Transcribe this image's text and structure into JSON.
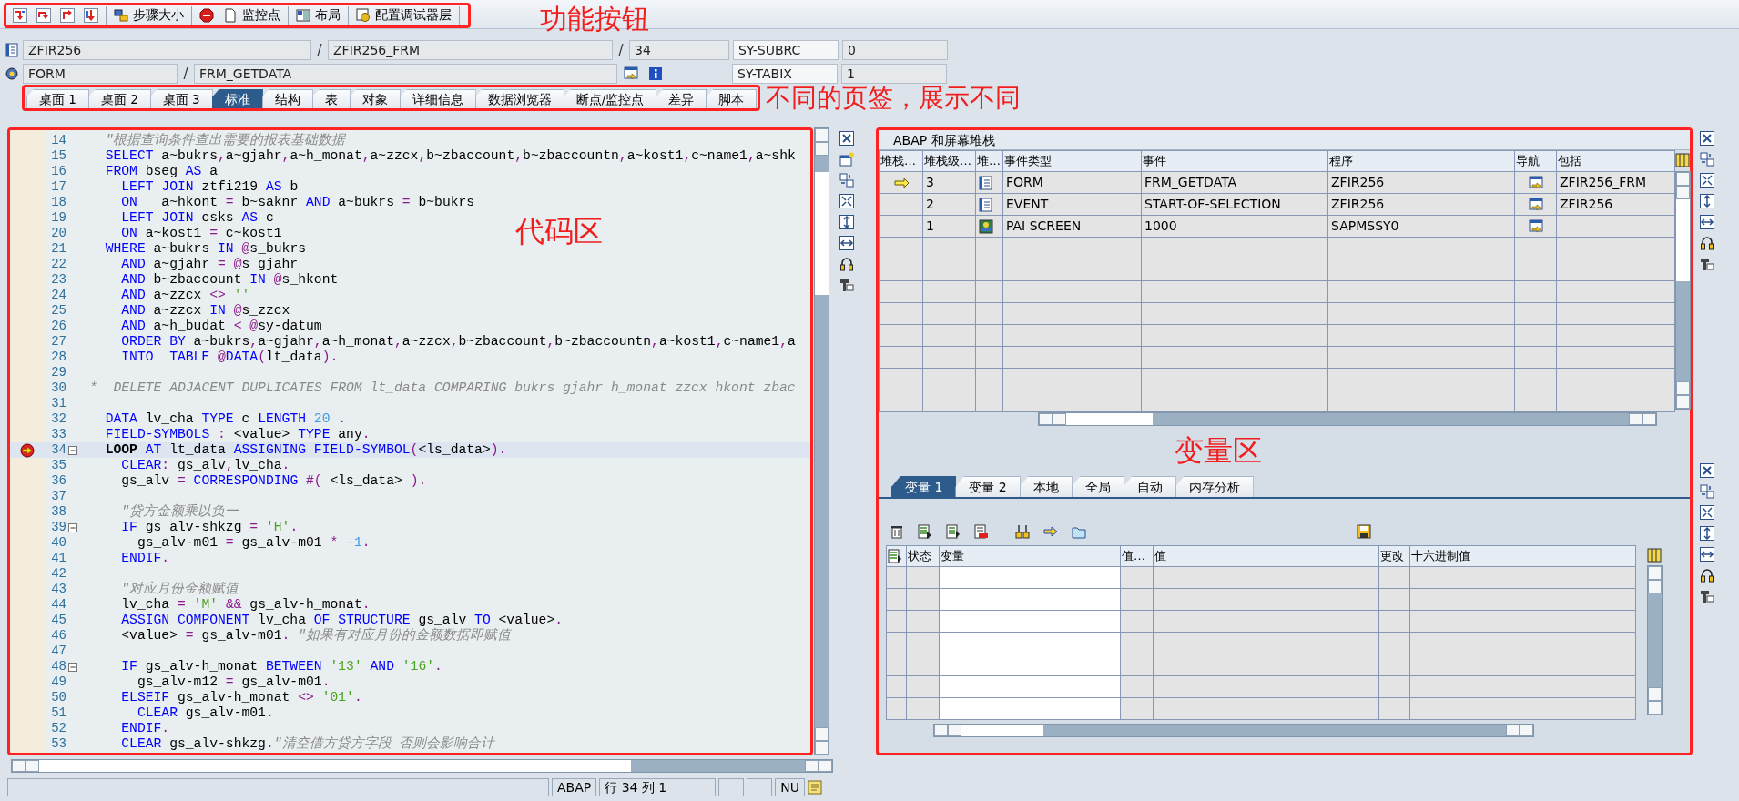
{
  "toolbar": {
    "annotation": "功能按钮",
    "buttons": [
      {
        "kind": "step-into"
      },
      {
        "kind": "step-over"
      },
      {
        "kind": "step-return"
      },
      {
        "kind": "continue"
      },
      {
        "kind": "step-size",
        "label": "步骤大小"
      },
      {
        "kind": "stop"
      },
      {
        "kind": "watchpoint",
        "label": "监控点"
      },
      {
        "kind": "layout",
        "label": "布局"
      },
      {
        "kind": "layers",
        "label": "配置调试器层"
      }
    ]
  },
  "header": {
    "rows": [
      {
        "kind": "program",
        "items": [
          {
            "kind": "field",
            "text": "ZFIR256"
          },
          {
            "kind": "sep",
            "text": "/"
          },
          {
            "kind": "field",
            "text": "ZFIR256_FRM"
          },
          {
            "kind": "sep",
            "text": "/"
          },
          {
            "kind": "field",
            "text": "34"
          }
        ],
        "sys_field": {
          "name": "SY-SUBRC",
          "value": "0"
        }
      },
      {
        "kind": "event",
        "items": [
          {
            "kind": "field",
            "text": "FORM"
          },
          {
            "kind": "sep",
            "text": "/"
          },
          {
            "kind": "field",
            "text": "FRM_GETDATA"
          },
          {
            "kind": "nav"
          },
          {
            "kind": "info"
          }
        ],
        "sys_field": {
          "name": "SY-TABIX",
          "value": "1"
        }
      }
    ]
  },
  "desktop_tabs": {
    "annotation": "不同的页签，展示不同",
    "tabs": [
      {
        "label": "桌面 1",
        "selected": false
      },
      {
        "label": "桌面 2",
        "selected": false
      },
      {
        "label": "桌面 3",
        "selected": false
      },
      {
        "label": "标准",
        "selected": true
      },
      {
        "label": "结构",
        "selected": false
      },
      {
        "label": "表",
        "selected": false
      },
      {
        "label": "对象",
        "selected": false
      },
      {
        "label": "详细信息",
        "selected": false
      },
      {
        "label": "数据浏览器",
        "selected": false
      },
      {
        "label": "断点/监控点",
        "selected": false
      },
      {
        "label": "差异",
        "selected": false
      },
      {
        "label": "脚本",
        "selected": false
      }
    ]
  },
  "code_area": {
    "annotation": "代码区",
    "lines": [
      {
        "n": "14",
        "current": false,
        "fold": false,
        "tokens": [
          {
            "kind": "c",
            "text": "  \"根据查询条件查出需要的报表基础数据"
          }
        ]
      },
      {
        "n": "15",
        "current": false,
        "fold": false,
        "tokens": [
          {
            "kind": "kw",
            "text": "  SELECT"
          },
          {
            "kind": "t",
            "text": " a~bukrs"
          },
          {
            "kind": "o",
            "text": ","
          },
          {
            "kind": "t",
            "text": "a~gjahr"
          },
          {
            "kind": "o",
            "text": ","
          },
          {
            "kind": "t",
            "text": "a~h_monat"
          },
          {
            "kind": "o",
            "text": ","
          },
          {
            "kind": "t",
            "text": "a~zzcx"
          },
          {
            "kind": "o",
            "text": ","
          },
          {
            "kind": "t",
            "text": "b~zbaccount"
          },
          {
            "kind": "o",
            "text": ","
          },
          {
            "kind": "t",
            "text": "b~zbaccountn"
          },
          {
            "kind": "o",
            "text": ","
          },
          {
            "kind": "t",
            "text": "a~kost1"
          },
          {
            "kind": "o",
            "text": ","
          },
          {
            "kind": "t",
            "text": "c~name1"
          },
          {
            "kind": "o",
            "text": ","
          },
          {
            "kind": "t",
            "text": "a~shk"
          }
        ]
      },
      {
        "n": "16",
        "current": false,
        "fold": false,
        "tokens": [
          {
            "kind": "kw",
            "text": "  FROM"
          },
          {
            "kind": "t",
            "text": " bseg "
          },
          {
            "kind": "kw",
            "text": "AS"
          },
          {
            "kind": "t",
            "text": " a"
          }
        ]
      },
      {
        "n": "17",
        "current": false,
        "fold": false,
        "tokens": [
          {
            "kind": "kw",
            "text": "    LEFT JOIN"
          },
          {
            "kind": "t",
            "text": " ztfi219 "
          },
          {
            "kind": "kw",
            "text": "AS"
          },
          {
            "kind": "t",
            "text": " b"
          }
        ]
      },
      {
        "n": "18",
        "current": false,
        "fold": false,
        "tokens": [
          {
            "kind": "kw",
            "text": "    ON"
          },
          {
            "kind": "t",
            "text": "   a~hkont "
          },
          {
            "kind": "o",
            "text": "="
          },
          {
            "kind": "t",
            "text": " b~saknr "
          },
          {
            "kind": "kw",
            "text": "AND"
          },
          {
            "kind": "t",
            "text": " a~bukrs "
          },
          {
            "kind": "o",
            "text": "="
          },
          {
            "kind": "t",
            "text": " b~bukrs"
          }
        ]
      },
      {
        "n": "19",
        "current": false,
        "fold": false,
        "tokens": [
          {
            "kind": "kw",
            "text": "    LEFT JOIN"
          },
          {
            "kind": "t",
            "text": " csks "
          },
          {
            "kind": "kw",
            "text": "AS"
          },
          {
            "kind": "t",
            "text": " c"
          }
        ]
      },
      {
        "n": "20",
        "current": false,
        "fold": false,
        "tokens": [
          {
            "kind": "kw",
            "text": "    ON"
          },
          {
            "kind": "t",
            "text": " a~kost1 "
          },
          {
            "kind": "o",
            "text": "="
          },
          {
            "kind": "t",
            "text": " c~kost1"
          }
        ]
      },
      {
        "n": "21",
        "current": false,
        "fold": false,
        "tokens": [
          {
            "kind": "kw",
            "text": "  WHERE"
          },
          {
            "kind": "t",
            "text": " a~bukrs "
          },
          {
            "kind": "kw",
            "text": "IN"
          },
          {
            "kind": "o",
            "text": " @"
          },
          {
            "kind": "t",
            "text": "s_bukrs"
          }
        ]
      },
      {
        "n": "22",
        "current": false,
        "fold": false,
        "tokens": [
          {
            "kind": "kw",
            "text": "    AND"
          },
          {
            "kind": "t",
            "text": " a~gjahr "
          },
          {
            "kind": "o",
            "text": "= @"
          },
          {
            "kind": "t",
            "text": "s_gjahr"
          }
        ]
      },
      {
        "n": "23",
        "current": false,
        "fold": false,
        "tokens": [
          {
            "kind": "kw",
            "text": "    AND"
          },
          {
            "kind": "t",
            "text": " b~zbaccount "
          },
          {
            "kind": "kw",
            "text": "IN"
          },
          {
            "kind": "o",
            "text": " @"
          },
          {
            "kind": "t",
            "text": "s_hkont"
          }
        ]
      },
      {
        "n": "24",
        "current": false,
        "fold": false,
        "tokens": [
          {
            "kind": "kw",
            "text": "    AND"
          },
          {
            "kind": "t",
            "text": " a~zzcx "
          },
          {
            "kind": "o",
            "text": "<>"
          },
          {
            "kind": "s",
            "text": " ''"
          }
        ]
      },
      {
        "n": "25",
        "current": false,
        "fold": false,
        "tokens": [
          {
            "kind": "kw",
            "text": "    AND"
          },
          {
            "kind": "t",
            "text": " a~zzcx "
          },
          {
            "kind": "kw",
            "text": "IN"
          },
          {
            "kind": "o",
            "text": " @"
          },
          {
            "kind": "t",
            "text": "s_zzcx"
          }
        ]
      },
      {
        "n": "26",
        "current": false,
        "fold": false,
        "tokens": [
          {
            "kind": "kw",
            "text": "    AND"
          },
          {
            "kind": "t",
            "text": " a~h_budat "
          },
          {
            "kind": "o",
            "text": "< @"
          },
          {
            "kind": "t",
            "text": "sy-datum"
          }
        ]
      },
      {
        "n": "27",
        "current": false,
        "fold": false,
        "tokens": [
          {
            "kind": "kw",
            "text": "    ORDER BY"
          },
          {
            "kind": "t",
            "text": " a~bukrs"
          },
          {
            "kind": "o",
            "text": ","
          },
          {
            "kind": "t",
            "text": "a~gjahr"
          },
          {
            "kind": "o",
            "text": ","
          },
          {
            "kind": "t",
            "text": "a~h_monat"
          },
          {
            "kind": "o",
            "text": ","
          },
          {
            "kind": "t",
            "text": "a~zzcx"
          },
          {
            "kind": "o",
            "text": ","
          },
          {
            "kind": "t",
            "text": "b~zbaccount"
          },
          {
            "kind": "o",
            "text": ","
          },
          {
            "kind": "t",
            "text": "b~zbaccountn"
          },
          {
            "kind": "o",
            "text": ","
          },
          {
            "kind": "t",
            "text": "a~kost1"
          },
          {
            "kind": "o",
            "text": ","
          },
          {
            "kind": "t",
            "text": "c~name1"
          },
          {
            "kind": "o",
            "text": ","
          },
          {
            "kind": "t",
            "text": "a"
          }
        ]
      },
      {
        "n": "28",
        "current": false,
        "fold": false,
        "tokens": [
          {
            "kind": "kw",
            "text": "    INTO  TABLE"
          },
          {
            "kind": "o",
            "text": " @"
          },
          {
            "kind": "kw",
            "text": "DATA"
          },
          {
            "kind": "o",
            "text": "("
          },
          {
            "kind": "t",
            "text": "lt_data"
          },
          {
            "kind": "o",
            "text": ")."
          }
        ]
      },
      {
        "n": "29",
        "current": false,
        "fold": false
      },
      {
        "n": "30",
        "current": false,
        "fold": false,
        "tokens": [
          {
            "kind": "c",
            "text": "*  DELETE ADJACENT DUPLICATES FROM lt_data COMPARING bukrs gjahr h_monat zzcx hkont zbac"
          }
        ]
      },
      {
        "n": "31",
        "current": false,
        "fold": false
      },
      {
        "n": "32",
        "current": false,
        "fold": false,
        "tokens": [
          {
            "kind": "kw",
            "text": "  DATA"
          },
          {
            "kind": "t",
            "text": " lv_cha "
          },
          {
            "kind": "kw",
            "text": "TYPE"
          },
          {
            "kind": "t",
            "text": " c "
          },
          {
            "kind": "kw",
            "text": "LENGTH"
          },
          {
            "kind": "n",
            "text": " 20"
          },
          {
            "kind": "o",
            "text": " ."
          }
        ]
      },
      {
        "n": "33",
        "current": false,
        "fold": false,
        "tokens": [
          {
            "kind": "kw",
            "text": "  FIELD-SYMBOLS"
          },
          {
            "kind": "o",
            "text": " :"
          },
          {
            "kind": "t",
            "text": " <value> "
          },
          {
            "kind": "kw",
            "text": "TYPE"
          },
          {
            "kind": "t",
            "text": " any"
          },
          {
            "kind": "o",
            "text": "."
          }
        ]
      },
      {
        "n": "34",
        "current": true,
        "fold": true,
        "tokens": [
          {
            "kind": "b",
            "text": "  LOOP"
          },
          {
            "kind": "kw",
            "text": " AT"
          },
          {
            "kind": "t",
            "text": " lt_data "
          },
          {
            "kind": "kw",
            "text": "ASSIGNING FIELD-SYMBOL"
          },
          {
            "kind": "o",
            "text": "("
          },
          {
            "kind": "t",
            "text": "<ls_data>"
          },
          {
            "kind": "o",
            "text": ")."
          }
        ]
      },
      {
        "n": "35",
        "current": false,
        "fold": false,
        "tokens": [
          {
            "kind": "kw",
            "text": "    CLEAR"
          },
          {
            "kind": "o",
            "text": ":"
          },
          {
            "kind": "t",
            "text": " gs_alv"
          },
          {
            "kind": "o",
            "text": ","
          },
          {
            "kind": "t",
            "text": "lv_cha"
          },
          {
            "kind": "o",
            "text": "."
          }
        ]
      },
      {
        "n": "36",
        "current": false,
        "fold": false,
        "tokens": [
          {
            "kind": "t",
            "text": "    gs_alv "
          },
          {
            "kind": "o",
            "text": "="
          },
          {
            "kind": "kw",
            "text": " CORRESPONDING"
          },
          {
            "kind": "o",
            "text": " #("
          },
          {
            "kind": "t",
            "text": " <ls_data> "
          },
          {
            "kind": "o",
            "text": ")."
          }
        ]
      },
      {
        "n": "37",
        "current": false,
        "fold": false
      },
      {
        "n": "38",
        "current": false,
        "fold": false,
        "tokens": [
          {
            "kind": "c",
            "text": "    \"贷方金额乘以负一"
          }
        ]
      },
      {
        "n": "39",
        "current": false,
        "fold": true,
        "tokens": [
          {
            "kind": "kw",
            "text": "    IF"
          },
          {
            "kind": "t",
            "text": " gs_alv-shkzg "
          },
          {
            "kind": "o",
            "text": "="
          },
          {
            "kind": "s",
            "text": " 'H'"
          },
          {
            "kind": "o",
            "text": "."
          }
        ]
      },
      {
        "n": "40",
        "current": false,
        "fold": false,
        "tokens": [
          {
            "kind": "t",
            "text": "      gs_alv-m01 "
          },
          {
            "kind": "o",
            "text": "="
          },
          {
            "kind": "t",
            "text": " gs_alv-m01 "
          },
          {
            "kind": "o",
            "text": "*"
          },
          {
            "kind": "n",
            "text": " -1"
          },
          {
            "kind": "o",
            "text": "."
          }
        ]
      },
      {
        "n": "41",
        "current": false,
        "fold": false,
        "tokens": [
          {
            "kind": "kw",
            "text": "    ENDIF"
          },
          {
            "kind": "o",
            "text": "."
          }
        ]
      },
      {
        "n": "42",
        "current": false,
        "fold": false
      },
      {
        "n": "43",
        "current": false,
        "fold": false,
        "tokens": [
          {
            "kind": "c",
            "text": "    \"对应月份金额赋值"
          }
        ]
      },
      {
        "n": "44",
        "current": false,
        "fold": false,
        "tokens": [
          {
            "kind": "t",
            "text": "    lv_cha "
          },
          {
            "kind": "o",
            "text": "="
          },
          {
            "kind": "s",
            "text": " 'M'"
          },
          {
            "kind": "o",
            "text": " &&"
          },
          {
            "kind": "t",
            "text": " gs_alv-h_monat"
          },
          {
            "kind": "o",
            "text": "."
          }
        ]
      },
      {
        "n": "45",
        "current": false,
        "fold": false,
        "tokens": [
          {
            "kind": "kw",
            "text": "    ASSIGN COMPONENT"
          },
          {
            "kind": "t",
            "text": " lv_cha "
          },
          {
            "kind": "kw",
            "text": "OF STRUCTURE"
          },
          {
            "kind": "t",
            "text": " gs_alv "
          },
          {
            "kind": "kw",
            "text": "TO"
          },
          {
            "kind": "t",
            "text": " <value>"
          },
          {
            "kind": "o",
            "text": "."
          }
        ]
      },
      {
        "n": "46",
        "current": false,
        "fold": false,
        "tokens": [
          {
            "kind": "t",
            "text": "    <value> "
          },
          {
            "kind": "o",
            "text": "="
          },
          {
            "kind": "t",
            "text": " gs_alv-m01"
          },
          {
            "kind": "o",
            "text": "."
          },
          {
            "kind": "c",
            "text": " \"如果有对应月份的金额数据即赋值"
          }
        ]
      },
      {
        "n": "47",
        "current": false,
        "fold": false
      },
      {
        "n": "48",
        "current": false,
        "fold": true,
        "tokens": [
          {
            "kind": "kw",
            "text": "    IF"
          },
          {
            "kind": "t",
            "text": " gs_alv-h_monat "
          },
          {
            "kind": "kw",
            "text": "BETWEEN"
          },
          {
            "kind": "s",
            "text": " '13'"
          },
          {
            "kind": "kw",
            "text": " AND"
          },
          {
            "kind": "s",
            "text": " '16'"
          },
          {
            "kind": "o",
            "text": "."
          }
        ]
      },
      {
        "n": "49",
        "current": false,
        "fold": false,
        "tokens": [
          {
            "kind": "t",
            "text": "      gs_alv-m12 "
          },
          {
            "kind": "o",
            "text": "="
          },
          {
            "kind": "t",
            "text": " gs_alv-m01"
          },
          {
            "kind": "o",
            "text": "."
          }
        ]
      },
      {
        "n": "50",
        "current": false,
        "fold": false,
        "tokens": [
          {
            "kind": "kw",
            "text": "    ELSEIF"
          },
          {
            "kind": "t",
            "text": " gs_alv-h_monat "
          },
          {
            "kind": "o",
            "text": "<>"
          },
          {
            "kind": "s",
            "text": " '01'"
          },
          {
            "kind": "o",
            "text": "."
          }
        ]
      },
      {
        "n": "51",
        "current": false,
        "fold": false,
        "tokens": [
          {
            "kind": "kw",
            "text": "      CLEAR"
          },
          {
            "kind": "t",
            "text": " gs_alv-m01"
          },
          {
            "kind": "o",
            "text": "."
          }
        ]
      },
      {
        "n": "52",
        "current": false,
        "fold": false,
        "tokens": [
          {
            "kind": "kw",
            "text": "    ENDIF"
          },
          {
            "kind": "o",
            "text": "."
          }
        ]
      },
      {
        "n": "53",
        "current": false,
        "fold": false,
        "tokens": [
          {
            "kind": "kw",
            "text": "    CLEAR"
          },
          {
            "kind": "t",
            "text": " gs_alv-shkzg"
          },
          {
            "kind": "o",
            "text": "."
          },
          {
            "kind": "c",
            "text": "\"清空借方贷方字段 否则会影响合计"
          }
        ]
      }
    ]
  },
  "status_bar": {
    "language": "ABAP",
    "position": "行 34 列  1",
    "mode": "NU"
  },
  "stack": {
    "title": "ABAP 和屏幕堆栈",
    "columns": [
      "堆栈…",
      "堆栈级…",
      "堆…",
      "事件类型",
      "事件",
      "程序",
      "导航",
      "包括"
    ],
    "rows": [
      {
        "current": true,
        "stack_level": "3",
        "kind": "form",
        "event_type": "FORM",
        "event": "FRM_GETDATA",
        "program": "ZFIR256",
        "include": "ZFIR256_FRM"
      },
      {
        "current": false,
        "stack_level": "2",
        "kind": "event",
        "event_type": "EVENT",
        "event": "START-OF-SELECTION",
        "program": "ZFIR256",
        "include": "ZFIR256"
      },
      {
        "current": false,
        "stack_level": "1",
        "kind": "screen",
        "event_type": "PAI SCREEN",
        "event": "1000",
        "program": "SAPMSSY0"
      }
    ]
  },
  "variables_annotation": "变量区",
  "variables": {
    "tabs": [
      {
        "label": "变量 1",
        "selected": true
      },
      {
        "label": "变量 2",
        "selected": false
      },
      {
        "label": "本地",
        "selected": false
      },
      {
        "label": "全局",
        "selected": false
      },
      {
        "label": "自动",
        "selected": false
      },
      {
        "label": "内存分析",
        "selected": false
      }
    ],
    "columns": [
      "状态",
      "变量",
      "值…",
      "值",
      "更改",
      "十六进制值"
    ]
  }
}
